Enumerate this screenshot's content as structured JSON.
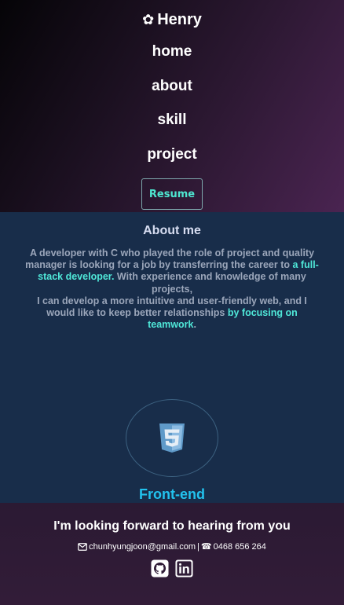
{
  "header": {
    "logo_icon": "✿",
    "logo_text": "Henry",
    "nav": [
      "home",
      "about",
      "skill",
      "project"
    ],
    "resume_label": "Resume"
  },
  "about": {
    "title": "About me",
    "desc_1": "A developer with C who played the role of project and quality manager is looking for a job by transferring the career to ",
    "highlight_1": "a full-stack developer.",
    "desc_2": " With experience and knowledge of many projects,",
    "desc_3": "I can develop a more intuitive and user-friendly web, and I would like to keep better relationships ",
    "highlight_2": "by focusing on teamwork",
    "desc_4": "."
  },
  "skill": {
    "icon": "css3-icon",
    "title": "Front-end"
  },
  "footer": {
    "title": "I'm looking forward to hearing from you",
    "email": "chunhyungjoon@gmail.com",
    "separator": "|",
    "phone_icon": "☎",
    "phone": "0468 656 264",
    "socials": [
      "github-icon",
      "linkedin-icon"
    ]
  },
  "colors": {
    "accent": "#4fe7d8",
    "skill_title": "#22c2ee",
    "about_bg": "#182d4a"
  }
}
